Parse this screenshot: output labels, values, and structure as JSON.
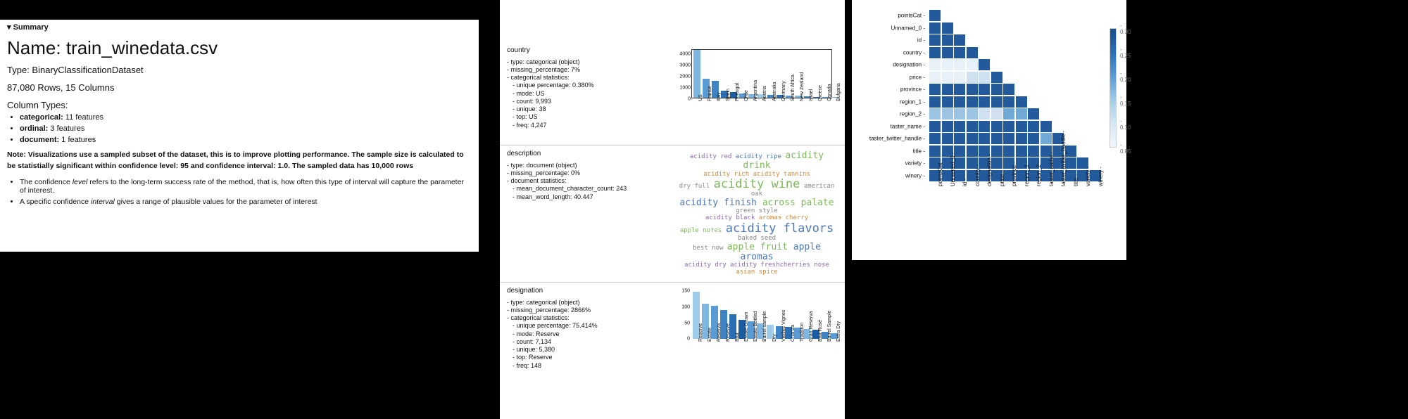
{
  "summary": {
    "caret_label": "Summary",
    "name_prefix": "Name: ",
    "name": "train_winedata.csv",
    "type_prefix": "Type: ",
    "type": "BinaryClassificationDataset",
    "shape": "87,080 Rows, 15 Columns",
    "coltypes_title": "Column Types:",
    "coltypes": [
      {
        "k": "categorical:",
        "v": " 11 features"
      },
      {
        "k": "ordinal:",
        "v": " 3 features"
      },
      {
        "k": "document:",
        "v": " 1 features"
      }
    ],
    "note": "Note: Visualizations use a sampled subset of the dataset, this is to improve plotting performance. The sample size is calculated to be statistially significant within confidence level: 95 and confidence interval: 1.0. The sampled data has 10,000 rows",
    "bullets": [
      {
        "pre": "The confidence ",
        "em": "level",
        "post": " refers to the long-term success rate of the method, that is, how often this type of interval will capture the parameter of interest."
      },
      {
        "pre": "A specific confidence ",
        "em": "interval",
        "post": " gives a range of plausible values for the parameter of interest"
      }
    ]
  },
  "features": {
    "country": {
      "name": "country",
      "stats": [
        "- type: categorical (object)",
        "- missing_percentage: 7%",
        "- categorical statistics:",
        "  - unique percentage: 0.380%",
        "  - mode: US",
        "  - count: 9,993",
        "  - unique: 38",
        "  - top: US",
        "  - freq: 4,247"
      ]
    },
    "description": {
      "name": "description",
      "stats": [
        "- type: document (object)",
        "- missing_percentage: 0%",
        "- document statistics:",
        "  - mean_document_character_count: 243",
        "  - mean_word_length: 40.447"
      ]
    },
    "designation": {
      "name": "designation",
      "stats": [
        "- type: categorical (object)",
        "- missing_percentage: 2866%",
        "- categorical statistics:",
        "  - unique percentage: 75.414%",
        "  - mode: Reserve",
        "  - count: 7,134",
        "  - unique: 5,380",
        "  - top: Reserve",
        "  - freq: 148"
      ]
    }
  },
  "wordcloud": {
    "lines": [
      [
        {
          "t": "acidity red",
          "c": "wc-p"
        },
        {
          "t": " acidity ripe ",
          "c": "wc-b"
        },
        {
          "t": "acidity drink",
          "c": "wc-g",
          "s": "wc-med"
        }
      ],
      [
        {
          "t": "acidity rich ",
          "c": "wc-o"
        },
        {
          "t": "acidity tannins",
          "c": "wc-o"
        }
      ],
      [
        {
          "t": "dry full ",
          "c": "wc-gr"
        },
        {
          "t": "acidity wine",
          "c": "wc-g",
          "s": "wc-big"
        },
        {
          "t": " american oak",
          "c": "wc-gr"
        }
      ],
      [
        {
          "t": "acidity finish ",
          "c": "wc-b",
          "s": "wc-med"
        },
        {
          "t": "across palate",
          "c": "wc-g",
          "s": "wc-med"
        },
        {
          "t": " green style",
          "c": "wc-gr"
        }
      ],
      [
        {
          "t": "acidity black ",
          "c": "wc-p"
        },
        {
          "t": "aromas cherry",
          "c": "wc-o"
        }
      ],
      [
        {
          "t": "apple notes ",
          "c": "wc-g"
        },
        {
          "t": "acidity flavors",
          "c": "wc-b",
          "s": "wc-big"
        },
        {
          "t": " baked seed",
          "c": "wc-gr"
        }
      ],
      [
        {
          "t": "best now ",
          "c": "wc-gr"
        },
        {
          "t": "apple fruit ",
          "c": "wc-g",
          "s": "wc-med"
        },
        {
          "t": "apple aromas",
          "c": "wc-b",
          "s": "wc-med"
        }
      ],
      [
        {
          "t": "acidity dry acidity freshcherries nose",
          "c": "wc-p"
        },
        {
          "t": " asian spice",
          "c": "wc-o"
        }
      ]
    ]
  },
  "heatmap": {
    "labels": [
      "pointsCat",
      "Unnamed_0",
      "id",
      "country",
      "designation",
      "price",
      "province",
      "region_1",
      "region_2",
      "taster_name",
      "taster_twitter_handle",
      "title",
      "variety",
      "winery"
    ],
    "colorbar_ticks": [
      "0.30",
      "0.25",
      "0.20",
      "0.15",
      "0.10",
      "0.05"
    ]
  },
  "chart_data": [
    {
      "type": "bar",
      "feature": "country",
      "categories": [
        "US",
        "France",
        "Italy",
        "Spain",
        "Portugal",
        "Chile",
        "Argentina",
        "Austria",
        "Australia",
        "Germany",
        "South Africa",
        "New Zealand",
        "Israel",
        "Greece",
        "Canada",
        "Bulgaria"
      ],
      "values": [
        4247,
        1700,
        1500,
        650,
        500,
        350,
        320,
        300,
        260,
        230,
        200,
        170,
        100,
        80,
        60,
        50
      ],
      "yticks": [
        0,
        1000,
        2000,
        3000,
        4000
      ],
      "ylim": [
        0,
        4400
      ],
      "colors": [
        "#7fb6e0",
        "#5a9bd4",
        "#3f84c4",
        "#2a6fb5",
        "#1a5da3",
        "#5a9bd4",
        "#7fb6e0",
        "#a0cbe8",
        "#3f84c4",
        "#2a6fb5",
        "#5a9bd4",
        "#7fb6e0",
        "#3f84c4",
        "#2a6fb5",
        "#5a9bd4",
        "#7fb6e0"
      ]
    },
    {
      "type": "wordcloud",
      "feature": "description"
    },
    {
      "type": "bar",
      "feature": "designation",
      "categories": [
        "Reserve",
        "Estate",
        "Reserva",
        "Reserve",
        "Brut",
        "Estate Grown",
        "Estate Bottled",
        "Barrel sample",
        "Dry",
        "Vieilles Vignes",
        "Crianza",
        "Tradition",
        "Gran Reserva",
        "Brut Rosé",
        "Barrel Sample",
        "Extra Dry"
      ],
      "values": [
        148,
        110,
        105,
        90,
        78,
        60,
        55,
        50,
        45,
        40,
        38,
        35,
        32,
        28,
        22,
        18
      ],
      "yticks": [
        0,
        50,
        100,
        150
      ],
      "ylim": [
        0,
        155
      ],
      "colors": [
        "#a0cbe8",
        "#7fb6e0",
        "#5a9bd4",
        "#3f84c4",
        "#2a6fb5",
        "#1a5da3",
        "#5a9bd4",
        "#7fb6e0",
        "#a0cbe8",
        "#3f84c4",
        "#2a6fb5",
        "#5a9bd4",
        "#7fb6e0",
        "#1a5da3",
        "#3f84c4",
        "#5a9bd4"
      ]
    },
    {
      "type": "heatmap",
      "labels": [
        "pointsCat",
        "Unnamed_0",
        "id",
        "country",
        "designation",
        "price",
        "province",
        "region_1",
        "region_2",
        "taster_name",
        "taster_twitter_handle",
        "title",
        "variety",
        "winery"
      ],
      "colorbar_range": [
        0.05,
        0.3
      ],
      "matrix_note": "Lower-triangular missingness-correlation heatmap; darker blue ≈ higher value. Notable lighter cells at (designation, pointsCat…id) and (price, pointsCat…id) rows; region_2 row shows mid-light values across early columns.",
      "cells_light": [
        {
          "r": 4,
          "c": 0,
          "shade": 0.92
        },
        {
          "r": 4,
          "c": 1,
          "shade": 0.92
        },
        {
          "r": 4,
          "c": 2,
          "shade": 0.92
        },
        {
          "r": 4,
          "c": 3,
          "shade": 0.88
        },
        {
          "r": 5,
          "c": 0,
          "shade": 0.9
        },
        {
          "r": 5,
          "c": 1,
          "shade": 0.9
        },
        {
          "r": 5,
          "c": 2,
          "shade": 0.9
        },
        {
          "r": 5,
          "c": 3,
          "shade": 0.85
        },
        {
          "r": 5,
          "c": 4,
          "shade": 0.85
        },
        {
          "r": 8,
          "c": 0,
          "shade": 0.6
        },
        {
          "r": 8,
          "c": 1,
          "shade": 0.6
        },
        {
          "r": 8,
          "c": 2,
          "shade": 0.6
        },
        {
          "r": 8,
          "c": 3,
          "shade": 0.55
        },
        {
          "r": 8,
          "c": 4,
          "shade": 0.75
        },
        {
          "r": 8,
          "c": 5,
          "shade": 0.75
        },
        {
          "r": 8,
          "c": 6,
          "shade": 0.5
        },
        {
          "r": 8,
          "c": 7,
          "shade": 0.5
        },
        {
          "r": 10,
          "c": 9,
          "shade": 0.4
        }
      ]
    }
  ]
}
